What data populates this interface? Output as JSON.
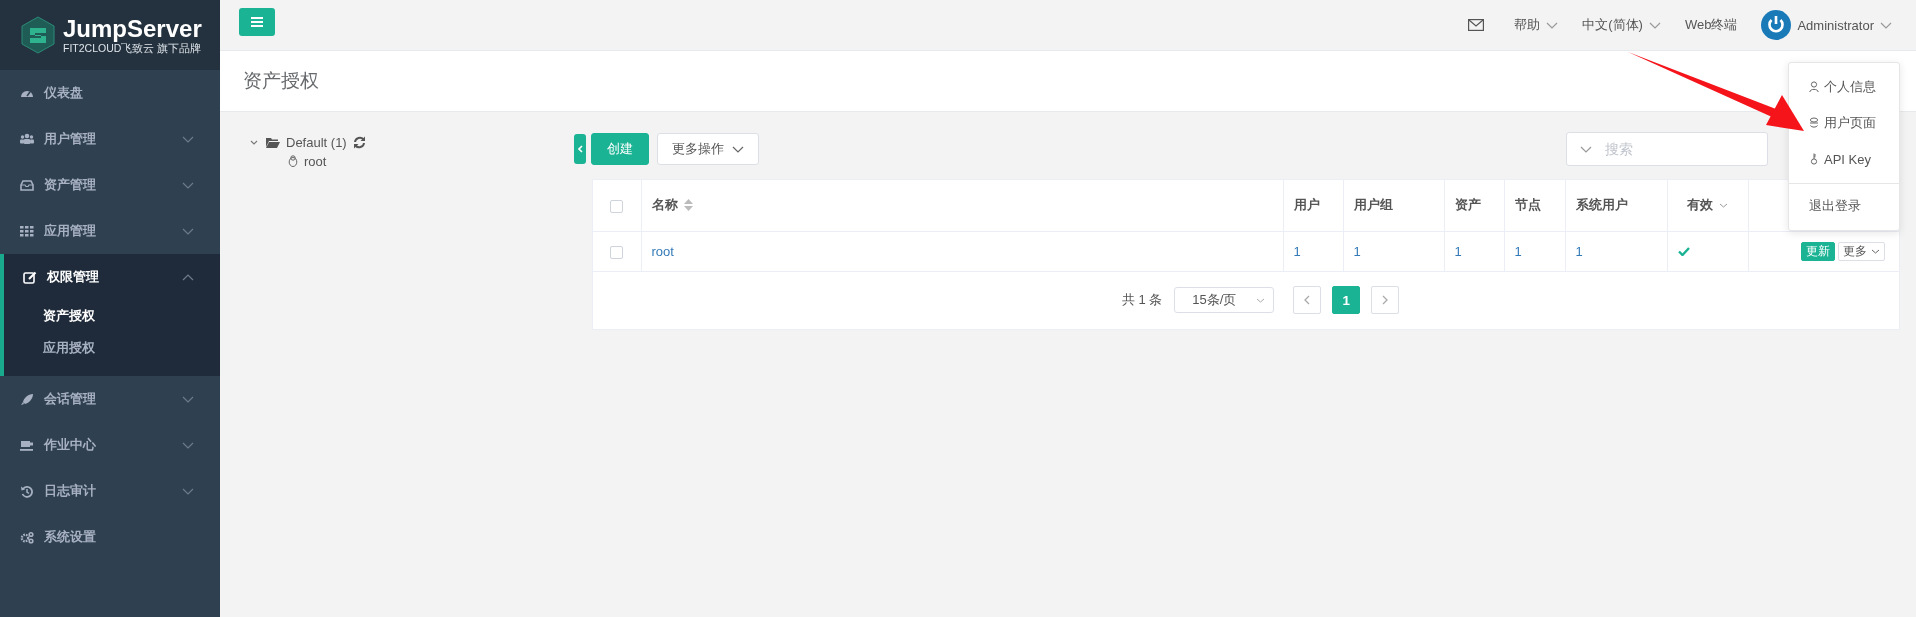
{
  "brand": {
    "name": "JumpServer",
    "tagline": "FIT2CLOUD飞致云 旗下品牌"
  },
  "sidebar": {
    "items": [
      {
        "label": "仪表盘"
      },
      {
        "label": "用户管理",
        "expanded": false
      },
      {
        "label": "资产管理",
        "expanded": false
      },
      {
        "label": "应用管理",
        "expanded": false
      },
      {
        "label": "权限管理",
        "expanded": true,
        "children": [
          {
            "label": "资产授权",
            "selected": true
          },
          {
            "label": "应用授权",
            "selected": false
          }
        ]
      },
      {
        "label": "会话管理",
        "expanded": false
      },
      {
        "label": "作业中心",
        "expanded": false
      },
      {
        "label": "日志审计",
        "expanded": false
      },
      {
        "label": "系统设置"
      }
    ]
  },
  "topbar": {
    "nav": [
      {
        "label": "帮助",
        "kind": "menu"
      },
      {
        "label": "中文(简体)",
        "kind": "menu"
      },
      {
        "label": "Web终端",
        "kind": "link"
      }
    ],
    "user": "Administrator"
  },
  "user_menu": {
    "groups": [
      [
        {
          "label": "个人信息"
        },
        {
          "label": "用户页面"
        },
        {
          "label": "API Key"
        }
      ],
      [
        {
          "label": "退出登录"
        }
      ]
    ]
  },
  "page": {
    "title": "资产授权"
  },
  "tree": {
    "label": "Default (1)",
    "expanded": true,
    "children": [
      {
        "label": "root"
      }
    ]
  },
  "toolbar": {
    "buttons": [
      {
        "label": "创建",
        "kind": "primary"
      },
      {
        "label": "更多操作",
        "kind": "menu"
      }
    ],
    "search": {
      "placeholder": "搜索"
    }
  },
  "table": {
    "header_checked": false,
    "columns": [
      {
        "label": "名称",
        "kind": "sortable"
      },
      {
        "label": "用户",
        "kind": "plain"
      },
      {
        "label": "用户组",
        "kind": "plain"
      },
      {
        "label": "资产",
        "kind": "plain"
      },
      {
        "label": "节点",
        "kind": "plain"
      },
      {
        "label": "系统用户",
        "kind": "plain"
      },
      {
        "label": "有效",
        "kind": "filter"
      }
    ],
    "rows": [
      {
        "checked": false,
        "cells": [
          "root",
          "1",
          "1",
          "1",
          "1",
          "1"
        ],
        "valid": true,
        "actions": [
          {
            "label": "更新",
            "kind": "primary"
          },
          {
            "label": "更多",
            "kind": "menu"
          }
        ]
      }
    ]
  },
  "pagination": {
    "total": "共 1 条",
    "page_size": "15条/页",
    "pages": [
      {
        "label": "1",
        "selected": true
      }
    ]
  },
  "annotations": [
    {
      "kind": "arrow"
    }
  ]
}
